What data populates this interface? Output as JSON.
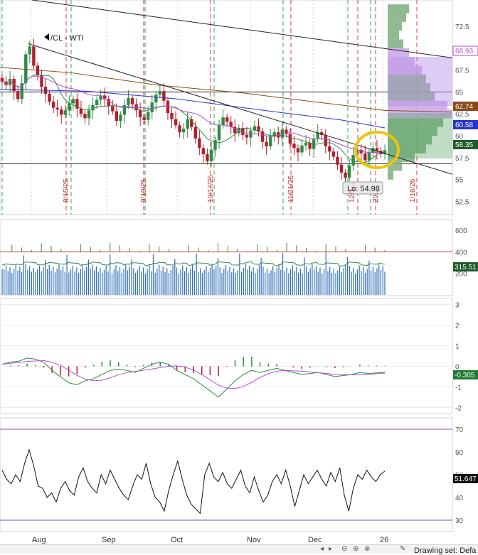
{
  "chart_data": [
    {
      "type": "candlestick",
      "title": "/CL - WTI",
      "ylim": [
        51.0,
        75.5
      ],
      "y_ticks": [
        52.5,
        55,
        57.5,
        60,
        62.5,
        65,
        67.5,
        70,
        72.5
      ],
      "low_annotation": "Lo: 54.98",
      "right_price_labels": [
        {
          "text": "68.93",
          "value": 68.93,
          "color": "#b34fd0"
        },
        {
          "text": "62.74",
          "value": 62.74,
          "color": "#8a4a1a"
        },
        {
          "text": "60.58",
          "value": 60.58,
          "color": "#2836c8"
        },
        {
          "text": "58.35",
          "value": 58.35,
          "color": "#1f5a2a"
        }
      ],
      "vertical_date_labels": [
        "8/15/25",
        "9/19/25",
        "10/17/25",
        "11/21/25",
        "12/1...",
        "20...",
        "1/16/26"
      ],
      "horizontal_levels": [
        65.0,
        56.8
      ],
      "close_sample": [
        66.2,
        65.8,
        66.5,
        65.1,
        64.2,
        66.0,
        69.3,
        70.2,
        68.0,
        66.9,
        65.6,
        64.8,
        63.9,
        63.2,
        63.0,
        62.4,
        62.9,
        63.7,
        64.2,
        63.1,
        62.5,
        62.0,
        62.9,
        63.5,
        64.1,
        64.6,
        64.2,
        63.4,
        62.8,
        61.7,
        62.4,
        63.5,
        64.3,
        63.6,
        62.9,
        62.1,
        61.8,
        62.7,
        63.8,
        64.7,
        65.1,
        64.0,
        62.6,
        61.9,
        61.2,
        60.4,
        60.8,
        61.9,
        61.0,
        59.7,
        58.6,
        57.9,
        57.1,
        58.4,
        59.5,
        61.2,
        62.1,
        61.6,
        61.0,
        60.3,
        60.9,
        60.1,
        59.8,
        60.6,
        61.1,
        60.5,
        59.3,
        58.8,
        59.9,
        60.4,
        59.8,
        60.7,
        60.2,
        59.1,
        58.6,
        58.1,
        58.9,
        59.2,
        58.5,
        59.6,
        60.4,
        60.1,
        58.8,
        58.2,
        57.6,
        56.7,
        55.8,
        55.2,
        56.6,
        57.8,
        58.4,
        58.0,
        57.2,
        58.1,
        58.6,
        58.3,
        57.9,
        58.35
      ]
    },
    {
      "type": "bar",
      "title": "",
      "ylim": [
        0,
        700
      ],
      "y_ticks": [
        200,
        400,
        600
      ],
      "last_value_label": "315.51"
    },
    {
      "type": "line",
      "title": "",
      "ylim": [
        -2.3,
        3.3
      ],
      "y_ticks": [
        -2,
        -1,
        0,
        1,
        2,
        3
      ],
      "last_value_label": "-0.305"
    },
    {
      "type": "line",
      "title": "",
      "ylim": [
        25,
        75
      ],
      "y_ticks": [
        30,
        40,
        50,
        60,
        70
      ],
      "last_value_label": "51.647"
    }
  ],
  "x_axis": {
    "month_labels": [
      "Aug",
      "Sep",
      "Oct",
      "Nov",
      "Dec",
      "26"
    ]
  },
  "toolbar": {
    "drawing_set_label": "Drawing set: Defa",
    "icons": [
      "scroll-left-icon",
      "scroll-right-icon",
      "zoom-out-icon",
      "zoom-in-icon",
      "crosshair-icon",
      "drawing-pencil-icon"
    ]
  },
  "colors": {
    "up": "#2e8b46",
    "down": "#b51d2a",
    "volume_bar": "#2f6eb5",
    "macd_line": "#2b8a3e",
    "macd_signal": "#b34fd0",
    "highlight_circle": "#f0c20a"
  }
}
